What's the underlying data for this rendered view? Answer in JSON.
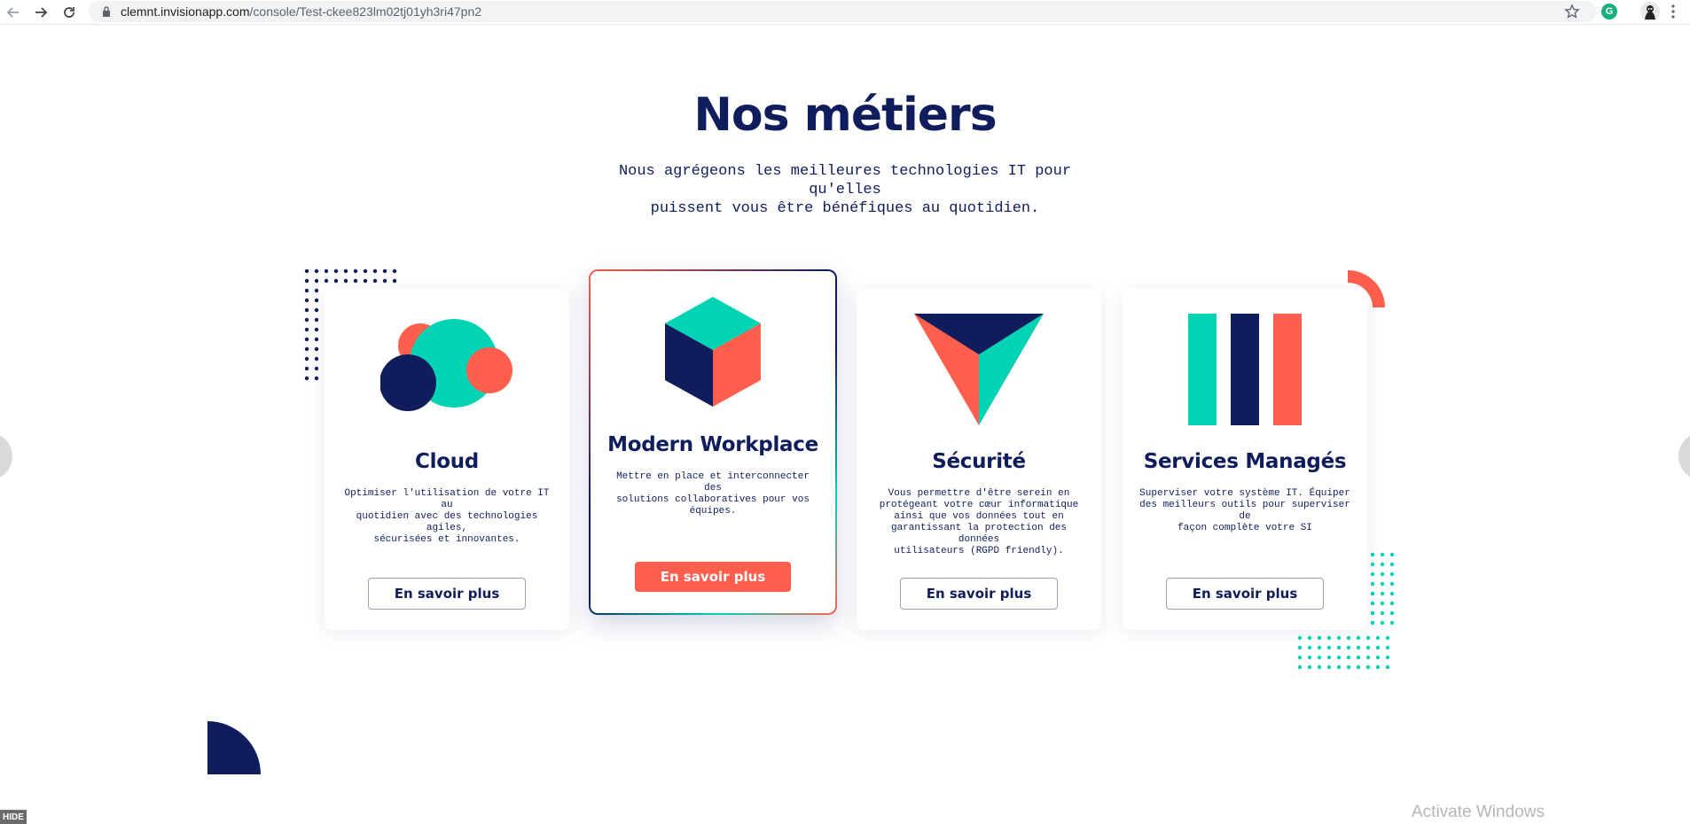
{
  "browser": {
    "url_host": "clemnt.invisionapp.com",
    "url_path": "/console/Test-ckee823lm02tj01yh3ri47pn2",
    "icons": [
      "back-icon",
      "forward-icon",
      "reload-icon",
      "lock-icon",
      "star-icon",
      "grammarly-icon",
      "avatar",
      "menu-icon"
    ],
    "grammarly_letter": "G"
  },
  "header": {
    "title": "Nos métiers",
    "subtitle_line1": "Nous agrégeons les meilleures technologies IT pour qu'elles",
    "subtitle_line2": "puissent vous être bénéfiques au quotidien."
  },
  "cards": [
    {
      "title": "Cloud",
      "desc_lines": [
        "Optimiser l'utilisation de votre IT au",
        "quotidien avec des technologies agiles,",
        "sécurisées et innovantes."
      ],
      "button": "En savoir plus",
      "icon": "cloud-icon"
    },
    {
      "title": "Modern Workplace",
      "desc_lines": [
        "Mettre en place et interconnecter des",
        "solutions collaboratives pour vos",
        "équipes."
      ],
      "button": "En savoir plus",
      "icon": "cube-icon",
      "highlighted": true
    },
    {
      "title": "Sécurité",
      "desc_lines": [
        "Vous permettre d'être serein en",
        "protégeant votre cœur informatique",
        "ainsi que vos données  tout en",
        "garantissant la protection des données",
        "utilisateurs (RGPD friendly)."
      ],
      "button": "En savoir plus",
      "icon": "shield-triangle-icon"
    },
    {
      "title": "Services Managés",
      "desc_lines": [
        "Superviser votre système IT. Équiper",
        "des meilleurs outils pour superviser de",
        "façon complète votre SI"
      ],
      "button": "En savoir plus",
      "icon": "bars-icon"
    }
  ],
  "colors": {
    "navy": "#0f1d5c",
    "teal": "#00d4b4",
    "coral": "#ff5f4c"
  },
  "footer": {
    "hide_label": "HIDE",
    "watermark": "Activate Windows"
  }
}
